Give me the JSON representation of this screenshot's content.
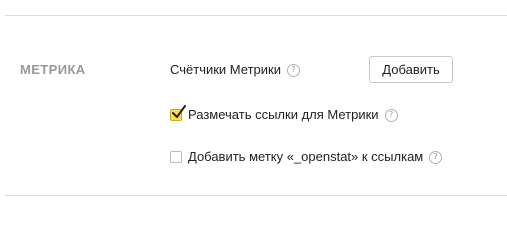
{
  "section": {
    "label": "МЕТРИКА"
  },
  "counters": {
    "label": "Счётчики Метрики",
    "help_icon": "question-circle-icon",
    "add_button_label": "Добавить"
  },
  "options": {
    "markup_links": {
      "label": "Размечать ссылки для Метрики",
      "checked": true
    },
    "openstat_tag": {
      "label": "Добавить метку «_openstat» к ссылкам",
      "checked": false
    }
  },
  "colors": {
    "checkbox_checked_fill": "#ffdb4d",
    "section_label": "#999999",
    "divider": "#dcdcdc"
  }
}
